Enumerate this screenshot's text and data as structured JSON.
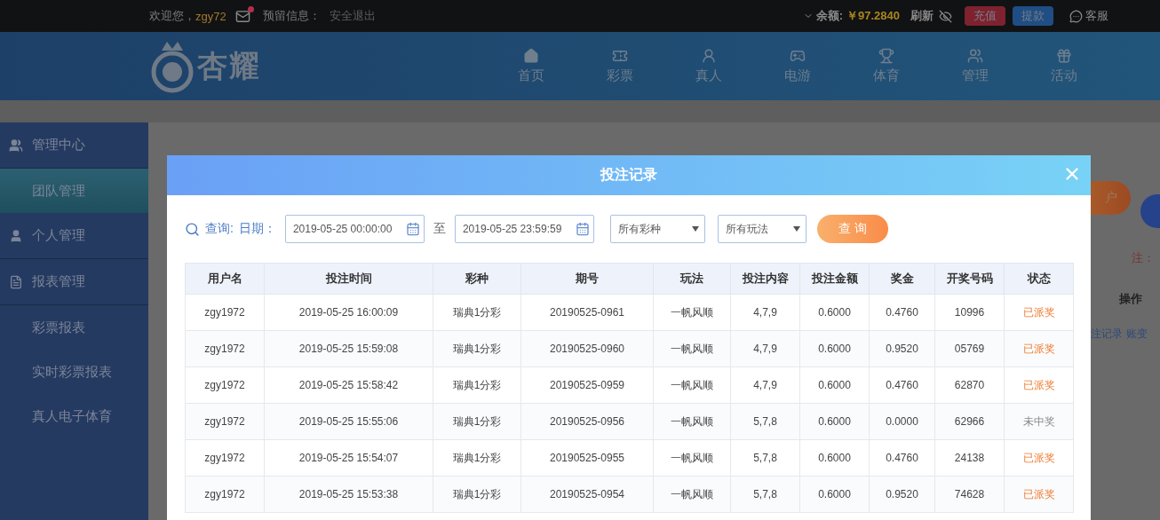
{
  "topbar": {
    "welcome": "欢迎您，",
    "username": "zgy72",
    "mail_unread": true,
    "reserved_info": "预留信息：",
    "logout": "安全退出",
    "balance_label": "余额:",
    "balance": "￥97.2840",
    "refresh": "刷新",
    "deposit": "充值",
    "withdraw": "提款",
    "service": "客服"
  },
  "logo": {
    "text": "杏耀"
  },
  "nav": [
    {
      "label": "首页"
    },
    {
      "label": "彩票"
    },
    {
      "label": "真人"
    },
    {
      "label": "电游"
    },
    {
      "label": "体育"
    },
    {
      "label": "管理"
    },
    {
      "label": "活动"
    }
  ],
  "sidebar": {
    "items": [
      {
        "label": "管理中心",
        "selected": false,
        "kind": "group"
      },
      {
        "label": "团队管理",
        "selected": true,
        "kind": "link"
      },
      {
        "label": "个人管理",
        "selected": false,
        "kind": "group"
      },
      {
        "label": "报表管理",
        "selected": false,
        "kind": "group"
      },
      {
        "label": "彩票报表",
        "selected": false,
        "kind": "link"
      },
      {
        "label": "实时彩票报表",
        "selected": false,
        "kind": "link"
      },
      {
        "label": "真人电子体育",
        "selected": false,
        "kind": "link"
      }
    ]
  },
  "background": {
    "open_account": "户",
    "note": "注：",
    "column": "操作",
    "links": [
      "注记录",
      "账变"
    ]
  },
  "modal": {
    "title": "投注记录",
    "query": {
      "label": "查询:",
      "date_label": "日期：",
      "from": "2019-05-25 00:00:00",
      "to_label": "至",
      "to": "2019-05-25 23:59:59",
      "lottery": "所有彩种",
      "play": "所有玩法",
      "button": "查 询"
    },
    "table": {
      "columns": [
        "用户名",
        "投注时间",
        "彩种",
        "期号",
        "玩法",
        "投注内容",
        "投注金额",
        "奖金",
        "开奖号码",
        "状态"
      ],
      "rows": [
        {
          "cells": [
            "zgy1972",
            "2019-05-25 16:00:09",
            "瑞典1分彩",
            "20190525-0961",
            "一帆风顺",
            "4,7,9",
            "0.6000",
            "0.4760",
            "10996",
            "已派奖"
          ],
          "kind": "paid"
        },
        {
          "cells": [
            "zgy1972",
            "2019-05-25 15:59:08",
            "瑞典1分彩",
            "20190525-0960",
            "一帆风顺",
            "4,7,9",
            "0.6000",
            "0.9520",
            "05769",
            "已派奖"
          ],
          "kind": "paid"
        },
        {
          "cells": [
            "zgy1972",
            "2019-05-25 15:58:42",
            "瑞典1分彩",
            "20190525-0959",
            "一帆风顺",
            "4,7,9",
            "0.6000",
            "0.4760",
            "62870",
            "已派奖"
          ],
          "kind": "paid"
        },
        {
          "cells": [
            "zgy1972",
            "2019-05-25 15:55:06",
            "瑞典1分彩",
            "20190525-0956",
            "一帆风顺",
            "5,7,8",
            "0.6000",
            "0.0000",
            "62966",
            "未中奖"
          ],
          "kind": "lost"
        },
        {
          "cells": [
            "zgy1972",
            "2019-05-25 15:54:07",
            "瑞典1分彩",
            "20190525-0955",
            "一帆风顺",
            "5,7,8",
            "0.6000",
            "0.4760",
            "24138",
            "已派奖"
          ],
          "kind": "paid"
        },
        {
          "cells": [
            "zgy1972",
            "2019-05-25 15:53:38",
            "瑞典1分彩",
            "20190525-0954",
            "一帆风顺",
            "5,7,8",
            "0.6000",
            "0.9520",
            "74628",
            "已派奖"
          ],
          "kind": "paid"
        }
      ]
    }
  }
}
